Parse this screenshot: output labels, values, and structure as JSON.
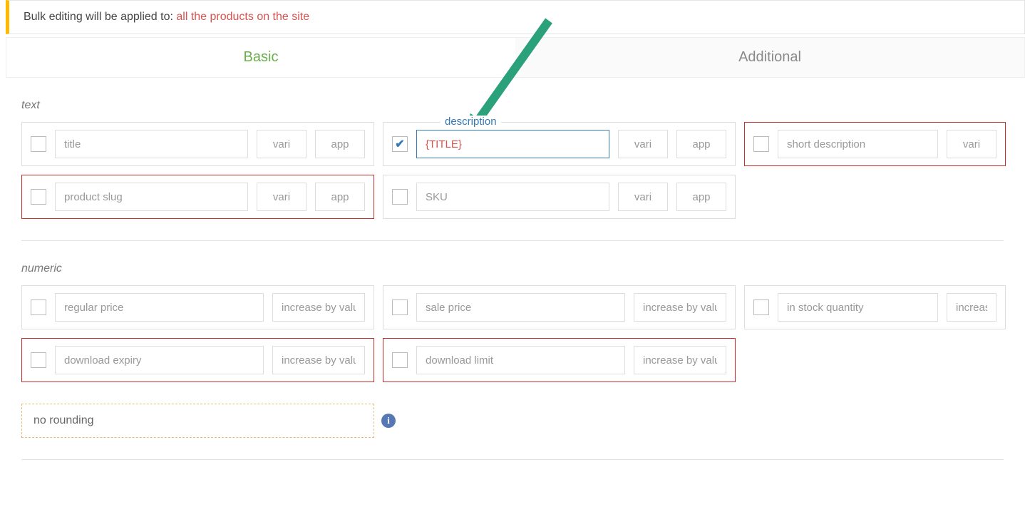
{
  "notice": {
    "prefix": "Bulk editing will be applied to: ",
    "target": "all the products on the site"
  },
  "tabs": {
    "basic": "Basic",
    "additional": "Additional"
  },
  "sections": {
    "text": "text",
    "numeric": "numeric"
  },
  "buttons": {
    "vari": "vari",
    "app": "app"
  },
  "text_fields": {
    "title": {
      "placeholder": "title"
    },
    "description": {
      "label": "description",
      "value": "{TITLE}"
    },
    "short_description": {
      "placeholder": "short description"
    },
    "product_slug": {
      "placeholder": "product slug"
    },
    "sku": {
      "placeholder": "SKU"
    }
  },
  "numeric_fields": {
    "regular_price": {
      "placeholder": "regular price",
      "mod": "increase by value"
    },
    "sale_price": {
      "placeholder": "sale price",
      "mod": "increase by value"
    },
    "in_stock": {
      "placeholder": "in stock quantity",
      "mod": "increase by value"
    },
    "download_expiry": {
      "placeholder": "download expiry",
      "mod": "increase by value"
    },
    "download_limit": {
      "placeholder": "download limit",
      "mod": "increase by value"
    }
  },
  "rounding": {
    "label": "no rounding"
  }
}
